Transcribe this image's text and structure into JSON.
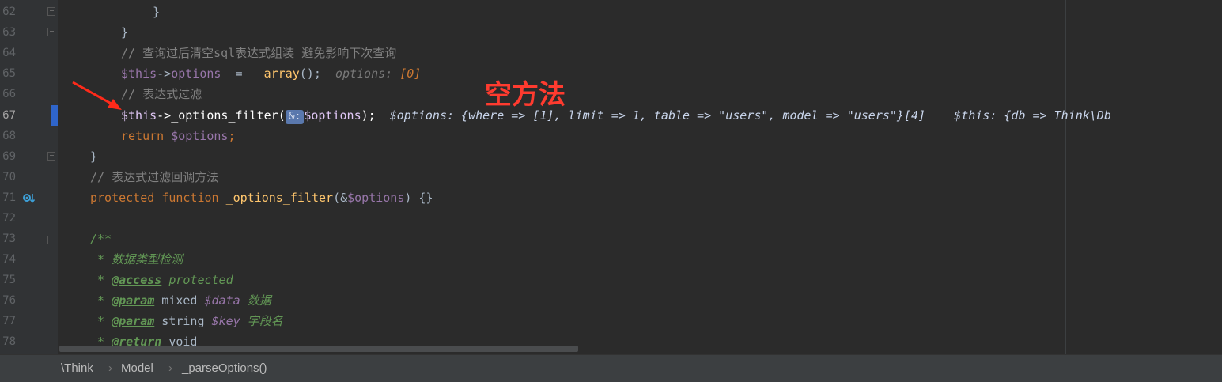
{
  "annotation": "空方法",
  "gutter": {
    "line_numbers": [
      "62",
      "63",
      "64",
      "65",
      "66",
      "67",
      "68",
      "69",
      "70",
      "71",
      "72",
      "73",
      "74",
      "75",
      "76",
      "77",
      "78"
    ]
  },
  "code": {
    "l62": "}",
    "l63": "}",
    "l64_comment": "// 查询过后清空sql表达式组装 避免影响下次查询",
    "l65": {
      "this": "$this",
      "arrow": "->",
      "prop": "options",
      "eq": "  =   ",
      "fn": "array",
      "rest": "();",
      "hint_label": "options: ",
      "hint_value": "[0]"
    },
    "l66_comment": "// 表达式过滤",
    "l67": {
      "this": "$this",
      "arrow": "->",
      "fn": "_options_filter",
      "open": "(",
      "badge": "&:",
      "arg": "$options",
      "close": ");",
      "hint1": "$options: {where => [1], limit => 1, table => \"users\", model => \"users\"}[4]",
      "hint2": "$this: {db => Think\\Db"
    },
    "l68": {
      "kw": "return",
      "var": "$options",
      "end": ";"
    },
    "l69": "}",
    "l70_comment": "// 表达式过滤回调方法",
    "l71": {
      "kw1": "protected",
      "kw2": "function",
      "fn": "_options_filter",
      "open": "(&",
      "arg": "$options",
      "rest": ") {}"
    },
    "l73": "/**",
    "l74": {
      "star": " * ",
      "text": "数据类型检测"
    },
    "l75": {
      "star": " * ",
      "tag": "@access",
      "text": " protected"
    },
    "l76": {
      "star": " * ",
      "tag": "@param",
      "type": " mixed ",
      "var": "$data",
      "text": " 数据"
    },
    "l77": {
      "star": " * ",
      "tag": "@param",
      "type": " string ",
      "var": "$key",
      "text": " 字段名"
    },
    "l78": {
      "star": " * ",
      "tag": "@return",
      "type": " void"
    }
  },
  "breadcrumb": [
    "\\Think",
    "Model",
    "_parseOptions()"
  ]
}
